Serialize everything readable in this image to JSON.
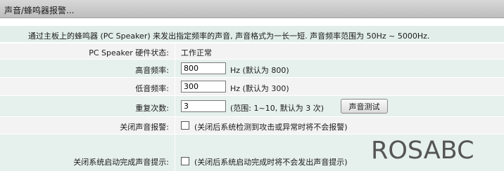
{
  "title": "声音/蜂鸣器报警...",
  "description": "通过主板上的蜂鸣器 (PC Speaker) 来发出指定频率的声音, 声音格式为一长一短. 声音频率范围为 50Hz ~ 5000Hz.",
  "status": {
    "label": "PC Speaker 硬件状态:",
    "value": "工作正常"
  },
  "high_freq": {
    "label": "高音频率:",
    "value": "800",
    "hint": "Hz (默认为 800)"
  },
  "low_freq": {
    "label": "低音频率:",
    "value": "300",
    "hint": "Hz (默认为 300)"
  },
  "repeat": {
    "label": "重复次数:",
    "value": "3",
    "hint": "(范围: 1~10, 默认为 3 次)",
    "test_button": "声音测试"
  },
  "disable_alarm": {
    "label": "关闭声音报警:",
    "checked": false,
    "hint": "(关闭后系统检测到攻击或异常时将不会报警)"
  },
  "disable_boot": {
    "label": "关闭系统启动完成声音提示:",
    "checked": false,
    "hint": "(关闭后系统启动完成时将不会发出声音提示)"
  },
  "watermark": "ROSABC"
}
